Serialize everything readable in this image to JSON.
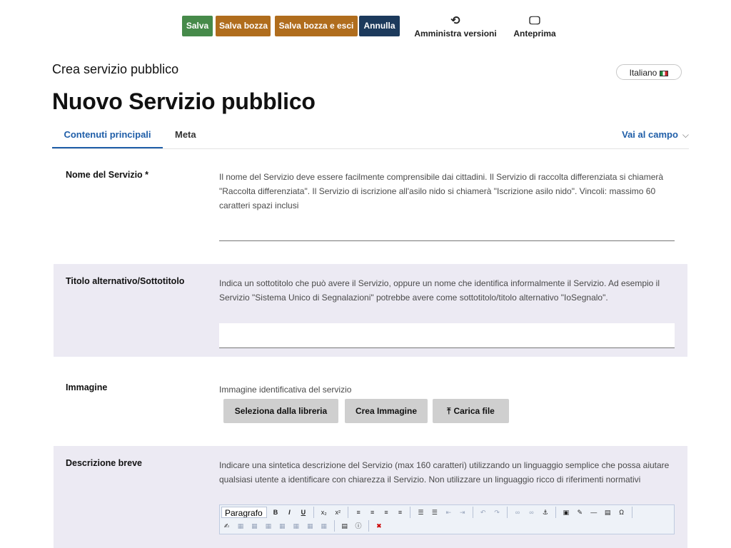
{
  "toolbar": {
    "save_label": "Salva",
    "save_draft_label": "Salva bozza",
    "save_draft_exit_label": "Salva bozza e esci",
    "cancel_label": "Annulla",
    "versions_label": "Amministra versioni",
    "preview_label": "Anteprima"
  },
  "header": {
    "context_title": "Crea servizio pubblico",
    "page_title": "Nuovo Servizio pubblico",
    "language": "Italiano"
  },
  "tabs": {
    "main": "Contenuti principali",
    "meta": "Meta",
    "goto_field": "Vai al campo"
  },
  "fields": {
    "service_name": {
      "label": "Nome del Servizio *",
      "help": "Il nome del Servizio deve essere facilmente comprensibile dai cittadini. Il Servizio di raccolta differenziata si chiamerà \"Raccolta differenziata\". Il Servizio di iscrizione all'asilo nido si chiamerà \"Iscrizione asilo nido\". Vincoli: massimo 60 caratteri spazi inclusi",
      "value": ""
    },
    "subtitle": {
      "label": "Titolo alternativo/Sottotitolo",
      "help": "Indica un sottotitolo che può avere il Servizio, oppure un nome che identifica informalmente il Servizio. Ad esempio il Servizio \"Sistema Unico di Segnalazioni\" potrebbe avere come sottotitolo/titolo alternativo \"IoSegnalo\".",
      "value": ""
    },
    "image": {
      "label": "Immagine",
      "help": "Immagine identificativa del servizio",
      "select_library": "Seleziona dalla libreria",
      "create_image": "Crea Immagine",
      "upload_file": "Carica file"
    },
    "short_description": {
      "label": "Descrizione breve",
      "help": "Indicare una sintetica descrizione del Servizio (max 160 caratteri) utilizzando un linguaggio semplice che possa aiutare qualsiasi utente a identificare con chiarezza il Servizio. Non utilizzare un linguaggio ricco di riferimenti normativi",
      "format_select": "Paragrafo"
    }
  },
  "colors": {
    "save": "#468a4a",
    "draft": "#b06d1d",
    "cancel": "#1c3a5c",
    "accent": "#1f5ea8",
    "section_alt_bg": "#eceaf3"
  }
}
